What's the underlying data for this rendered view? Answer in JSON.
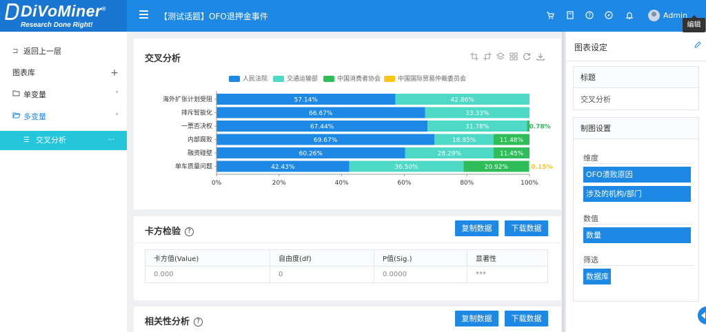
{
  "app": {
    "brand": "DiVoMiner",
    "brand_mark": "®",
    "slogan": "Research Done Right!",
    "page_title": "【测试话题】OFO退押金事件",
    "user": "Admin",
    "tooltip": "编辑",
    "header_icons": [
      "cart-icon",
      "book-icon",
      "help-icon",
      "compass-icon",
      "bell-icon"
    ]
  },
  "sidebar": {
    "items": [
      {
        "icon": "back-icon",
        "label": "返回上一层",
        "arrow": ""
      },
      {
        "icon": "",
        "label": "图表库",
        "arrow": "+"
      },
      {
        "icon": "folder-icon",
        "label": "单变量",
        "arrow": "˅"
      },
      {
        "icon": "folder-open-icon",
        "label": "多变量",
        "arrow": "˄"
      },
      {
        "icon": "list-icon",
        "label": "交叉分析",
        "arrow": "···"
      }
    ]
  },
  "chart_panel": {
    "title": "交叉分析",
    "toolbar_icons": [
      "crop-icon",
      "crop-alt-icon",
      "layers-icon",
      "grid-icon",
      "refresh-icon",
      "download-icon"
    ]
  },
  "chart_data": {
    "type": "bar",
    "orientation": "horizontal",
    "stacked": true,
    "percent": true,
    "categories": [
      "海外扩张计划受阻",
      "排斥智能化",
      "一票否决权",
      "内部腐败",
      "融资碰壁",
      "单车质量问题"
    ],
    "series": [
      {
        "name": "人民法院",
        "color": "#1e88e5",
        "values": [
          57.14,
          66.67,
          67.44,
          69.67,
          60.26,
          42.43
        ],
        "labels": [
          "57.14%",
          "66.67%",
          "67.44%",
          "69.67%",
          "60.26%",
          "42.43%"
        ]
      },
      {
        "name": "交通运输部",
        "color": "#4dd9c6",
        "values": [
          42.86,
          33.33,
          31.78,
          18.85,
          28.29,
          36.5
        ],
        "labels": [
          "42.86%",
          "33.33%",
          "31.78%",
          "18.85%",
          "28.29%",
          "36.50%"
        ]
      },
      {
        "name": "中国消费者协会",
        "color": "#2ebd59",
        "values": [
          0,
          0,
          0.78,
          11.48,
          11.45,
          20.92
        ],
        "labels": [
          "",
          "",
          "0.78%",
          "11.48%",
          "11.45%",
          "20.92%"
        ]
      },
      {
        "name": "中国国际贸易仲裁委员会",
        "color": "#ffc61a",
        "values": [
          0,
          0,
          0,
          0,
          0,
          0.15
        ],
        "labels": [
          "",
          "",
          "",
          "",
          "",
          "0.15%"
        ]
      }
    ],
    "xlim": [
      0,
      100
    ],
    "xticks": [
      "0%",
      "20%",
      "40%",
      "60%",
      "80%",
      "100%"
    ],
    "legend": "top"
  },
  "chi_square": {
    "title": "卡方检验",
    "help": "?",
    "copy_label": "复制数据",
    "download_label": "下载数据",
    "columns": [
      "卡方值(Value)",
      "自由度(df)",
      "P值(Sig.)",
      "显著性"
    ],
    "rows": [
      [
        "0.000",
        "0",
        "0.0000",
        "***"
      ]
    ]
  },
  "correlation": {
    "title": "相关性分析",
    "help": "?",
    "copy_label": "复制数据",
    "download_label": "下载数据"
  },
  "settings": {
    "title": "图表设定",
    "title_box_head": "标题",
    "title_value": "交叉分析",
    "plot_box_head": "制图设置",
    "dimension_label": "维度",
    "dimensions": [
      "OFO溃败原因",
      "涉及的机构/部门"
    ],
    "value_label": "数值",
    "value_tag": "数量",
    "filter_label": "筛选",
    "filter_tag": "数据库"
  }
}
